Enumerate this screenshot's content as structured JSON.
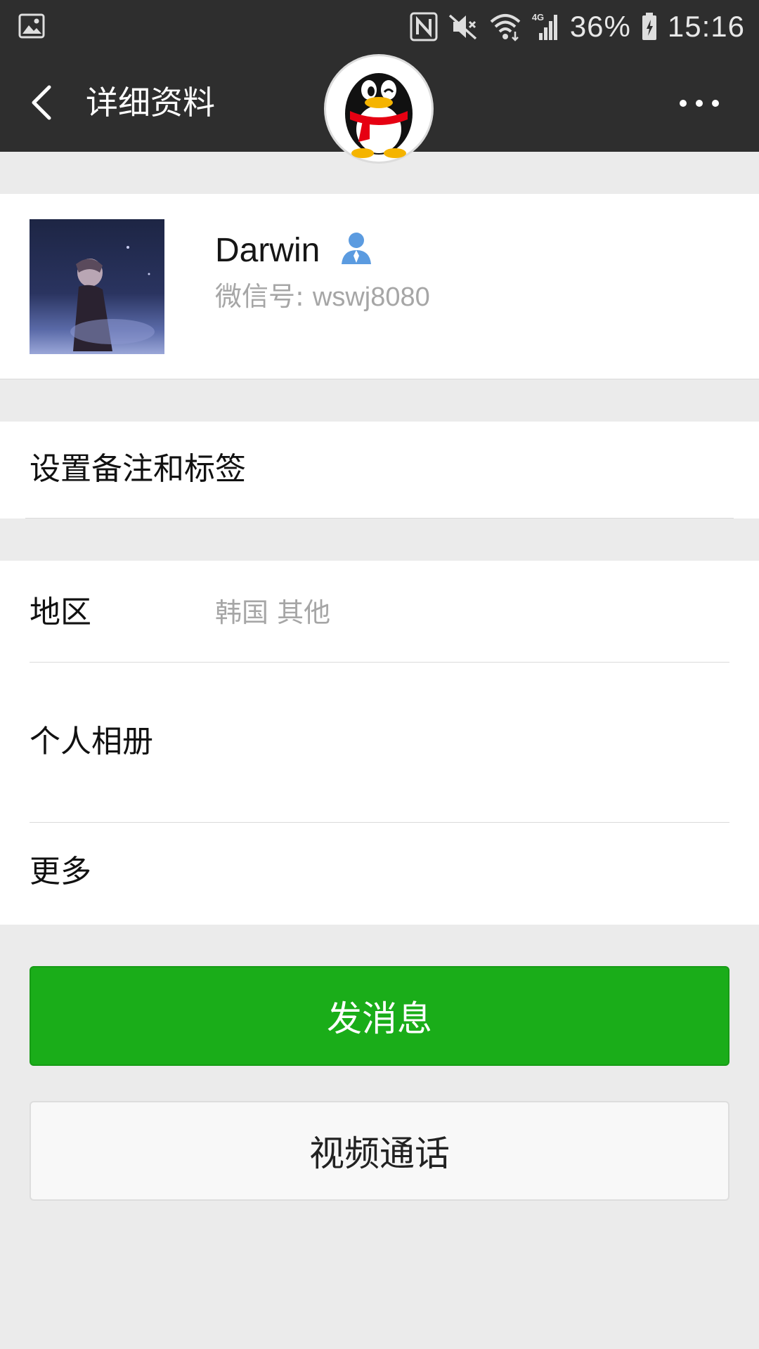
{
  "status_bar": {
    "battery": "36%",
    "time": "15:16",
    "network": "4G"
  },
  "nav": {
    "title": "详细资料"
  },
  "profile": {
    "name": "Darwin",
    "wechat_id_label": "微信号: ",
    "wechat_id": "wswj8080"
  },
  "rows": {
    "remark": "设置备注和标签",
    "region_label": "地区",
    "region_value": "韩国  其他",
    "album": "个人相册",
    "more": "更多"
  },
  "buttons": {
    "send_message": "发消息",
    "video_call": "视频通话"
  },
  "colors": {
    "header_bg": "#2e2e2e",
    "primary_green": "#1aad19",
    "page_bg": "#ebebeb",
    "contact_icon_blue": "#5b9be0"
  }
}
